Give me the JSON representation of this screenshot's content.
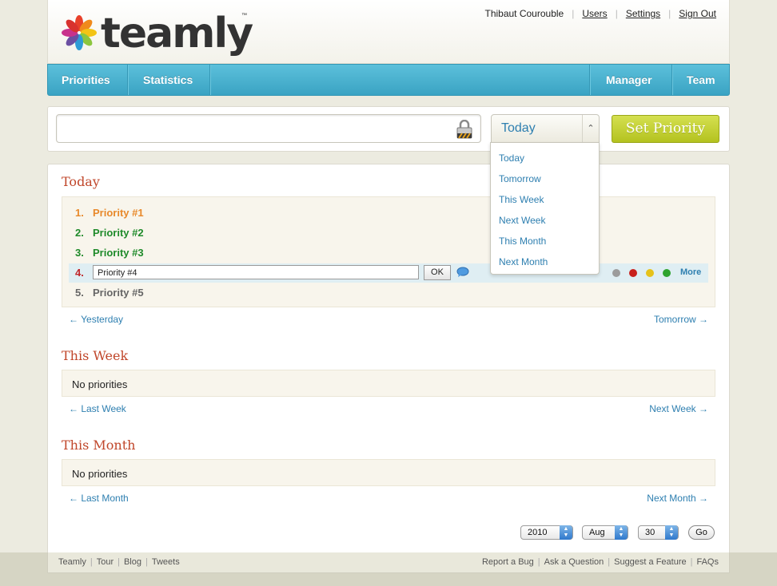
{
  "brand": {
    "name": "teamly",
    "tm": "™"
  },
  "user_links": {
    "user_name": "Thibaut Courouble",
    "users": "Users",
    "settings": "Settings",
    "sign_out": "Sign Out"
  },
  "nav": {
    "priorities": "Priorities",
    "statistics": "Statistics",
    "manager": "Manager",
    "team": "Team"
  },
  "input_bar": {
    "priority_value": "",
    "when_selected": "Today",
    "set_priority": "Set Priority"
  },
  "dropdown": {
    "options": [
      "Today",
      "Tomorrow",
      "This Week",
      "Next Week",
      "This Month",
      "Next Month"
    ]
  },
  "today": {
    "title": "Today",
    "priorities": [
      {
        "num": "1.",
        "label": "Priority #1",
        "color": "#e8892b"
      },
      {
        "num": "2.",
        "label": "Priority #2",
        "color": "#1f8a2a"
      },
      {
        "num": "3.",
        "label": "Priority #3",
        "color": "#1f8a2a"
      },
      {
        "num": "4.",
        "label": "Priority #4",
        "color": "#c0262a"
      },
      {
        "num": "5.",
        "label": "Priority #5",
        "color": "#666666"
      }
    ],
    "edit": {
      "value": "Priority #4",
      "ok": "OK",
      "more": "More"
    },
    "status_colors": [
      "#9c9c9c",
      "#c8201c",
      "#e6c21a",
      "#2fa42f"
    ],
    "prev_link": "← Yesterday",
    "next_link": "Tomorrow →"
  },
  "this_week": {
    "title": "This Week",
    "empty": "No priorities",
    "prev_link": "← Last Week",
    "next_link": "Next Week →"
  },
  "this_month": {
    "title": "This Month",
    "empty": "No priorities",
    "prev_link": "← Last Month",
    "next_link": "Next Month →"
  },
  "date_picker": {
    "year": "2010",
    "month": "Aug",
    "day": "30",
    "go": "Go"
  },
  "footer": {
    "left": [
      "Teamly",
      "Tour",
      "Blog",
      "Tweets"
    ],
    "right": [
      "Report a Bug",
      "Ask a Question",
      "Suggest a Feature",
      "FAQs"
    ]
  }
}
